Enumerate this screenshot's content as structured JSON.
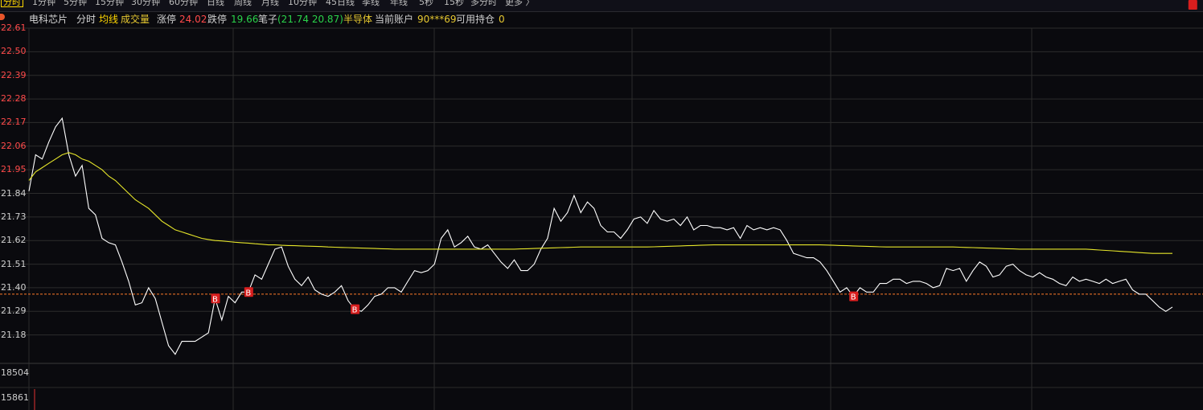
{
  "tabs": [
    "分时",
    "1分钟",
    "5分钟",
    "15分钟",
    "30分钟",
    "60分钟",
    "日线",
    "周线",
    "月线",
    "10分钟",
    "45日线",
    "季线",
    "年线",
    "5秒",
    "15秒",
    "多分时",
    "更多 〉"
  ],
  "info": {
    "stock_name": "电科芯片",
    "mode": "分时",
    "avg_line": "均线",
    "volume": "成交量",
    "limit_up_label": "涨停",
    "limit_up_value": "24.02",
    "limit_down_label": "跌停",
    "limit_down_value": "19.66",
    "bi_label": "笔子",
    "bi_value": "(21.74 20.87)",
    "sector": "半导体",
    "account_label": "当前账户",
    "account_value": "90***69",
    "holding_label": "可用持仓",
    "holding_value": "0"
  },
  "colors": {
    "price": "#ffffff",
    "avg": "#e6e62a",
    "up": "#ff4a4a",
    "down": "#2ad24a",
    "ref": "#ff7a2a",
    "grid": "#2c2c2c"
  },
  "chart_data": {
    "type": "line",
    "ylim": [
      21.07,
      22.61
    ],
    "y_ticks": [
      "22.61",
      "22.50",
      "22.39",
      "22.28",
      "22.17",
      "22.06",
      "21.95",
      "21.84",
      "21.73",
      "21.62",
      "21.51",
      "21.40",
      "21.29",
      "21.18"
    ],
    "y_ticks_red": [
      "22.61",
      "22.50",
      "22.39",
      "22.28",
      "22.17",
      "22.06",
      "21.95"
    ],
    "reference_price": 21.37,
    "volume_ticks": [
      "18504",
      "15861"
    ],
    "series": [
      {
        "key": "price",
        "values": [
          21.85,
          22.02,
          22.0,
          22.08,
          22.15,
          22.19,
          22.02,
          21.92,
          21.97,
          21.77,
          21.74,
          21.63,
          21.61,
          21.6,
          21.52,
          21.43,
          21.32,
          21.33,
          21.4,
          21.35,
          21.24,
          21.13,
          21.09,
          21.15,
          21.15,
          21.15,
          21.17,
          21.19,
          21.35,
          21.25,
          21.36,
          21.33,
          21.38,
          21.38,
          21.46,
          21.44,
          21.51,
          21.58,
          21.59,
          21.5,
          21.44,
          21.41,
          21.45,
          21.39,
          21.37,
          21.36,
          21.38,
          21.41,
          21.34,
          21.3,
          21.29,
          21.32,
          21.36,
          21.37,
          21.4,
          21.4,
          21.38,
          21.43,
          21.48,
          21.47,
          21.48,
          21.51,
          21.63,
          21.67,
          21.59,
          21.61,
          21.64,
          21.59,
          21.58,
          21.6,
          21.56,
          21.52,
          21.49,
          21.53,
          21.48,
          21.48,
          21.51,
          21.58,
          21.63,
          21.77,
          21.71,
          21.75,
          21.83,
          21.75,
          21.8,
          21.77,
          21.69,
          21.66,
          21.66,
          21.63,
          21.67,
          21.72,
          21.73,
          21.7,
          21.76,
          21.72,
          21.71,
          21.72,
          21.69,
          21.73,
          21.67,
          21.69,
          21.69,
          21.68,
          21.68,
          21.67,
          21.68,
          21.63,
          21.69,
          21.67,
          21.68,
          21.67,
          21.68,
          21.67,
          21.62,
          21.56,
          21.55,
          21.54,
          21.54,
          21.52,
          21.48,
          21.43,
          21.38,
          21.4,
          21.36,
          21.4,
          21.38,
          21.38,
          21.42,
          21.42,
          21.44,
          21.44,
          21.42,
          21.43,
          21.43,
          21.42,
          21.4,
          21.41,
          21.49,
          21.48,
          21.49,
          21.43,
          21.48,
          21.52,
          21.5,
          21.45,
          21.46,
          21.5,
          21.51,
          21.48,
          21.46,
          21.45,
          21.47,
          21.45,
          21.44,
          21.42,
          21.41,
          21.45,
          21.43,
          21.44,
          21.43,
          21.42,
          21.44,
          21.42,
          21.43,
          21.44,
          21.39,
          21.37,
          21.37,
          21.34,
          21.31,
          21.29,
          21.31
        ]
      },
      {
        "key": "avg",
        "values": [
          21.9,
          21.94,
          21.96,
          21.98,
          22.0,
          22.02,
          22.03,
          22.02,
          22.0,
          21.99,
          21.97,
          21.95,
          21.92,
          21.9,
          21.87,
          21.84,
          21.81,
          21.79,
          21.77,
          21.74,
          21.71,
          21.69,
          21.67,
          21.66,
          21.65,
          21.64,
          21.63,
          21.625,
          21.62,
          21.618,
          21.615,
          21.612,
          21.61,
          21.608,
          21.605,
          21.603,
          21.6,
          21.6,
          21.598,
          21.597,
          21.596,
          21.595,
          21.594,
          21.593,
          21.592,
          21.59,
          21.589,
          21.588,
          21.587,
          21.586,
          21.585,
          21.584,
          21.583,
          21.582,
          21.581,
          21.58,
          21.58,
          21.58,
          21.58,
          21.58,
          21.58,
          21.58,
          21.58,
          21.58,
          21.58,
          21.58,
          21.58,
          21.58,
          21.58,
          21.58,
          21.58,
          21.58,
          21.58,
          21.58,
          21.581,
          21.582,
          21.583,
          21.584,
          21.585,
          21.586,
          21.587,
          21.588,
          21.589,
          21.59,
          21.59,
          21.59,
          21.59,
          21.59,
          21.59,
          21.59,
          21.59,
          21.59,
          21.59,
          21.59,
          21.591,
          21.592,
          21.593,
          21.594,
          21.595,
          21.596,
          21.597,
          21.598,
          21.599,
          21.6,
          21.6,
          21.6,
          21.6,
          21.6,
          21.6,
          21.6,
          21.6,
          21.6,
          21.6,
          21.6,
          21.6,
          21.6,
          21.6,
          21.6,
          21.6,
          21.6,
          21.599,
          21.598,
          21.597,
          21.596,
          21.595,
          21.594,
          21.593,
          21.592,
          21.591,
          21.59,
          21.59,
          21.59,
          21.59,
          21.59,
          21.59,
          21.59,
          21.59,
          21.59,
          21.59,
          21.59,
          21.589,
          21.588,
          21.587,
          21.586,
          21.585,
          21.584,
          21.583,
          21.582,
          21.581,
          21.58,
          21.58,
          21.58,
          21.58,
          21.58,
          21.58,
          21.58,
          21.58,
          21.58,
          21.58,
          21.58,
          21.578,
          21.576,
          21.574,
          21.572,
          21.57,
          21.568,
          21.566,
          21.564,
          21.562,
          21.56,
          21.56,
          21.56,
          21.56
        ]
      }
    ],
    "markers": [
      {
        "label": "B",
        "index": 28
      },
      {
        "label": "B",
        "index": 33
      },
      {
        "label": "B",
        "index": 49
      },
      {
        "label": "B",
        "index": 124
      },
      {
        "label": "B",
        "index": 175
      }
    ]
  }
}
